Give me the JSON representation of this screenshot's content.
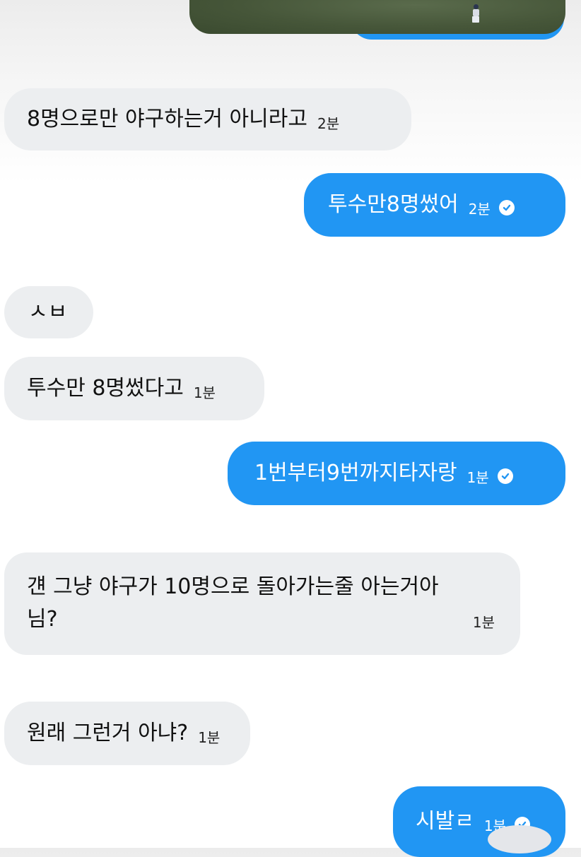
{
  "colors": {
    "sent_bubble": "#2196f3",
    "received_bubble": "#eceef0",
    "received_text": "#111111",
    "sent_text": "#ffffff"
  },
  "messages": [
    {
      "direction": "received",
      "text": "8명으로만 야구하는거 아니라고",
      "time": "2분"
    },
    {
      "direction": "sent",
      "text": "투수만8명썼어",
      "time": "2분",
      "status_icon": "check-circle-icon"
    },
    {
      "direction": "received",
      "text": "ㅅㅂ",
      "time": ""
    },
    {
      "direction": "received",
      "text": "투수만 8명썼다고",
      "time": "1분"
    },
    {
      "direction": "sent",
      "text": "1번부터9번까지타자랑",
      "time": "1분",
      "status_icon": "check-circle-icon"
    },
    {
      "direction": "received",
      "text": "걘 그냥 야구가 10명으로 돌아가는줄 아는거아님?",
      "time": "1분"
    },
    {
      "direction": "received",
      "text": "원래 그런거 아냐?",
      "time": "1분"
    },
    {
      "direction": "sent",
      "text": "시발ㄹ",
      "time": "1분",
      "status_icon": "check-circle-icon"
    }
  ]
}
